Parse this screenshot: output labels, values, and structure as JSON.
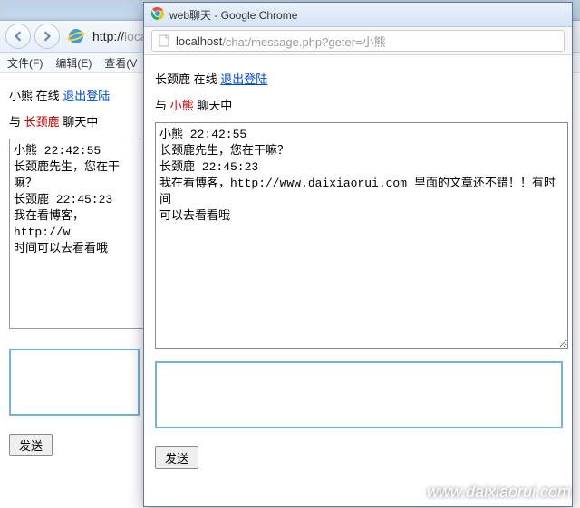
{
  "ie": {
    "url_black": "http://",
    "url_gray1": "local",
    "menu": {
      "file": "文件(F)",
      "edit": "编辑(E)",
      "view": "查看(V"
    },
    "status": {
      "user": "小熊",
      "online": "在线",
      "logout": "退出登陆"
    },
    "chat_with": {
      "pre": "与 ",
      "peer": "长颈鹿",
      "post": " 聊天中"
    },
    "messages": "小熊 22:42:55\n长颈鹿先生，您在干嘛？\n长颈鹿 22:45:23\n我在看博客，http://w\n时间可以去看看哦",
    "send": "发送"
  },
  "chrome": {
    "title": "web聊天 - Google Chrome",
    "url": {
      "host": "localhost",
      "path": "/chat/message.php?geter=小熊"
    },
    "status": {
      "user": "长颈鹿",
      "online": "在线",
      "logout": "退出登陆"
    },
    "chat_with": {
      "pre": "与 ",
      "peer": "小熊",
      "post": " 聊天中"
    },
    "messages": "小熊 22:42:55\n长颈鹿先生，您在干嘛？\n长颈鹿 22:45:23\n我在看博客，http://www.daixiaorui.com 里面的文章还不错！！有时间\n可以去看看哦",
    "send": "发送"
  },
  "watermark": "www.daixiaorui.com"
}
